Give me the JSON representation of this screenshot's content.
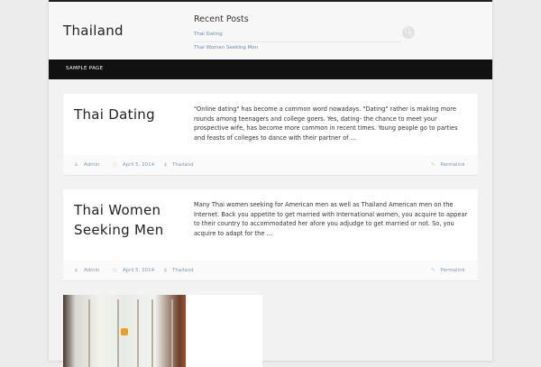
{
  "site": {
    "title": "Thailand"
  },
  "widget": {
    "title": "Recent Posts",
    "links": [
      "Thai Dating",
      "Thai Women Seeking Men"
    ]
  },
  "search": {
    "icon": "search-icon"
  },
  "nav": {
    "items": [
      "SAMPLE PAGE"
    ]
  },
  "posts": [
    {
      "title": "Thai Dating",
      "excerpt": "\"Online dating\" has become a common word nowadays. \"Dating\" rather is making more rounds among teenagers and college goers. Yes, dating- the chance to meet your prospective wife, has become more common in recent times. Young people go to parties and feasts of colleges to dance with their partner of …",
      "author": "Admin",
      "date": "April 5, 2014",
      "category": "Thailand",
      "permalink": "Permalink"
    },
    {
      "title": "Thai Women Seeking Men",
      "excerpt": "Many Thai women seeking for American men as well as Thailand American men on the Internet. Back you appetite to get married with International women, you acquire to appear to their country to accommodated her afore you adjudge to get married or not. So, you acquire to adapt for the …",
      "author": "Admin",
      "date": "April 5, 2014",
      "category": "Thailand",
      "permalink": "Permalink"
    }
  ]
}
